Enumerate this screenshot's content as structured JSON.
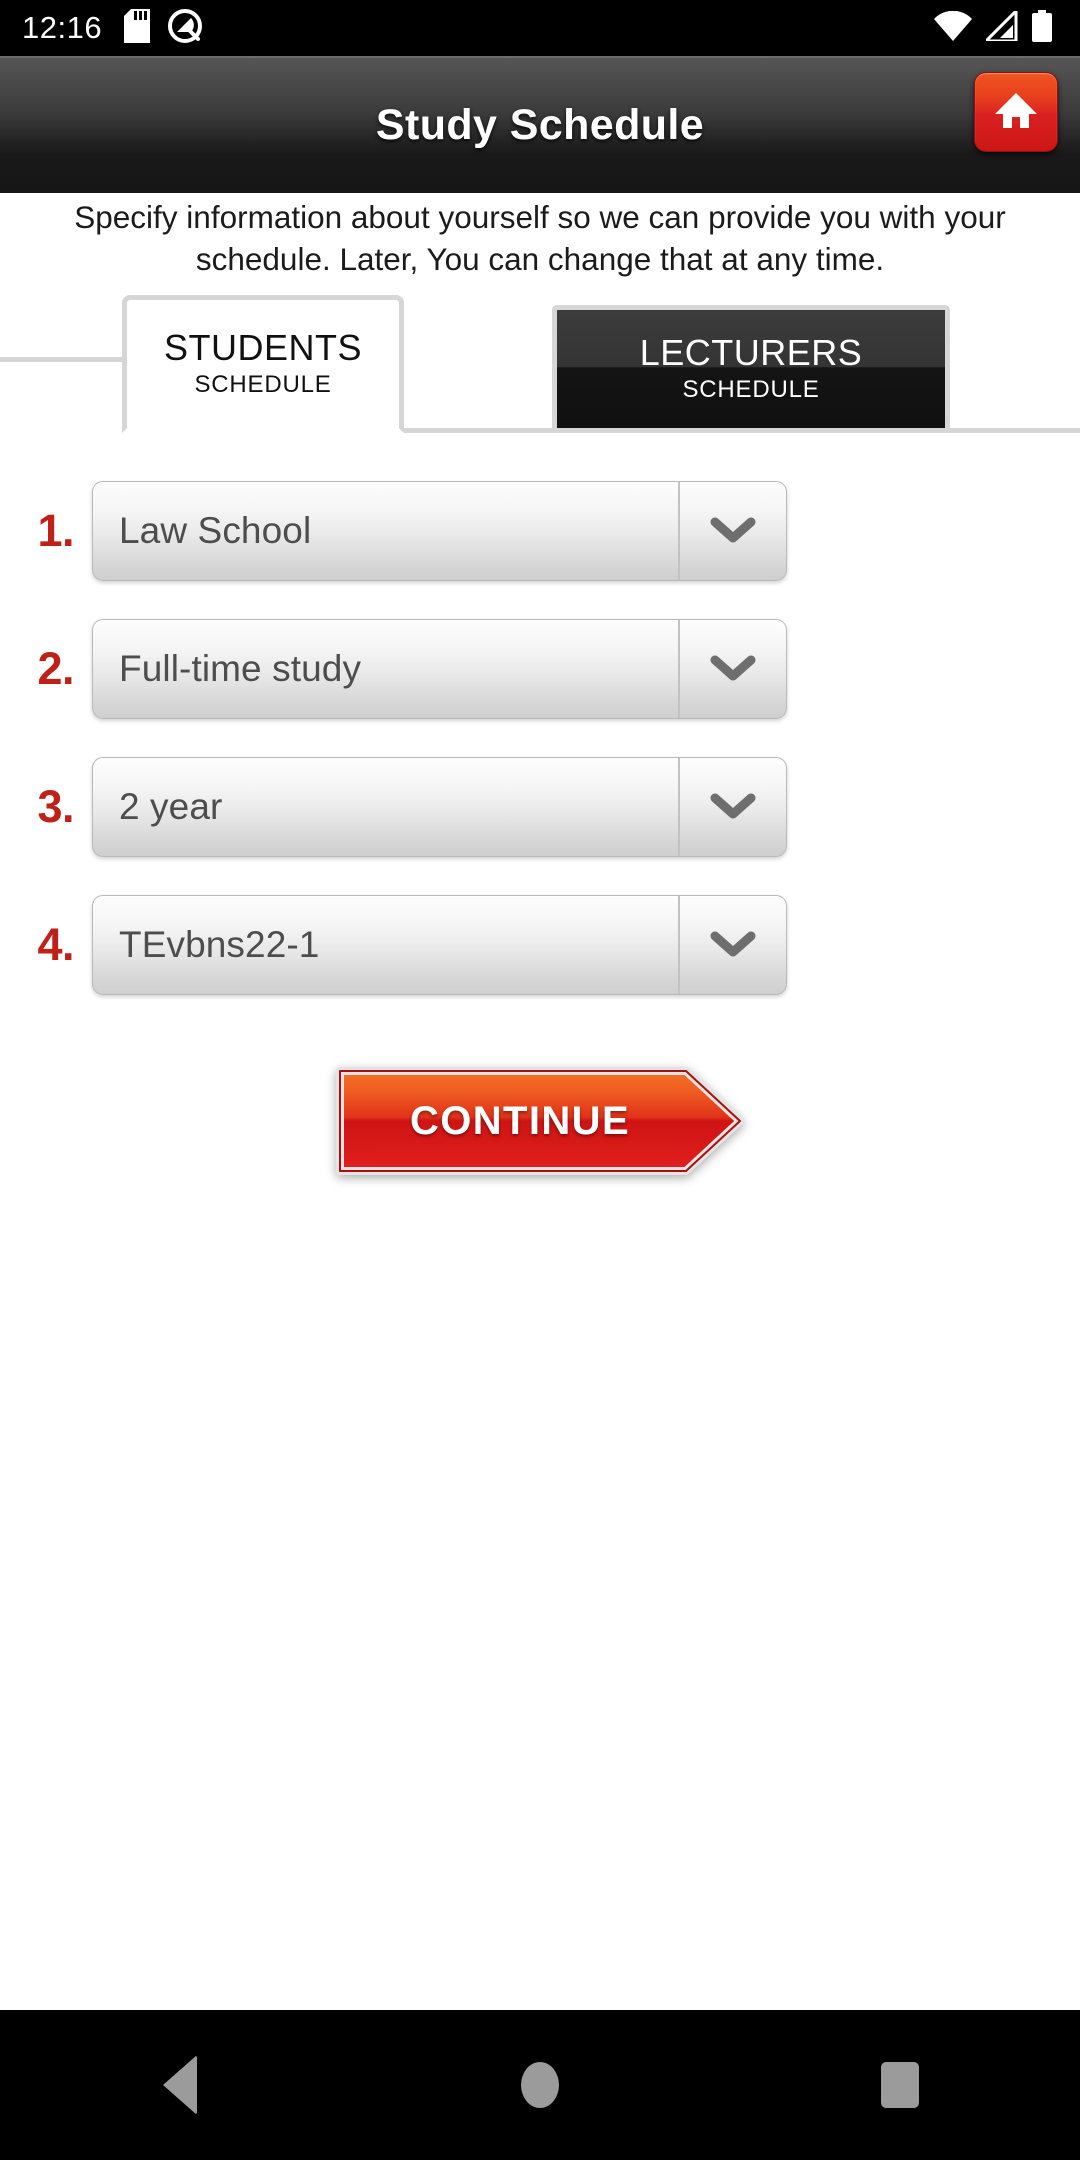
{
  "status_bar": {
    "clock": "12:16",
    "left_icons": [
      "sd-card-icon",
      "do-not-disturb-icon"
    ],
    "right_icons": [
      "wifi-icon",
      "cellular-signal-icon",
      "battery-icon"
    ]
  },
  "title_bar": {
    "title": "Study Schedule",
    "home_button_icon": "home-icon",
    "accent_color": "#d92020"
  },
  "description": "Specify information about yourself so we can provide you with your schedule. Later, You can change that at any time.",
  "tabs": [
    {
      "title": "STUDENTS",
      "subtitle": "SCHEDULE",
      "active": true
    },
    {
      "title": "LECTURERS",
      "subtitle": "SCHEDULE",
      "active": false
    }
  ],
  "form": {
    "rows": [
      {
        "number": "1.",
        "value": "Law School",
        "arrow_icon": "chevron-down-icon"
      },
      {
        "number": "2.",
        "value": "Full-time study",
        "arrow_icon": "chevron-down-icon"
      },
      {
        "number": "3.",
        "value": "2 year",
        "arrow_icon": "chevron-down-icon"
      },
      {
        "number": "4.",
        "value": "TEvbns22-1",
        "arrow_icon": "chevron-down-icon"
      }
    ],
    "number_color": "#bf2018"
  },
  "continue_button": {
    "label": "CONTINUE",
    "color_start": "#f26322",
    "color_end": "#cc1111"
  },
  "nav_bar": {
    "back": "back-icon",
    "home": "home-circle-icon",
    "recents": "recents-square-icon"
  }
}
